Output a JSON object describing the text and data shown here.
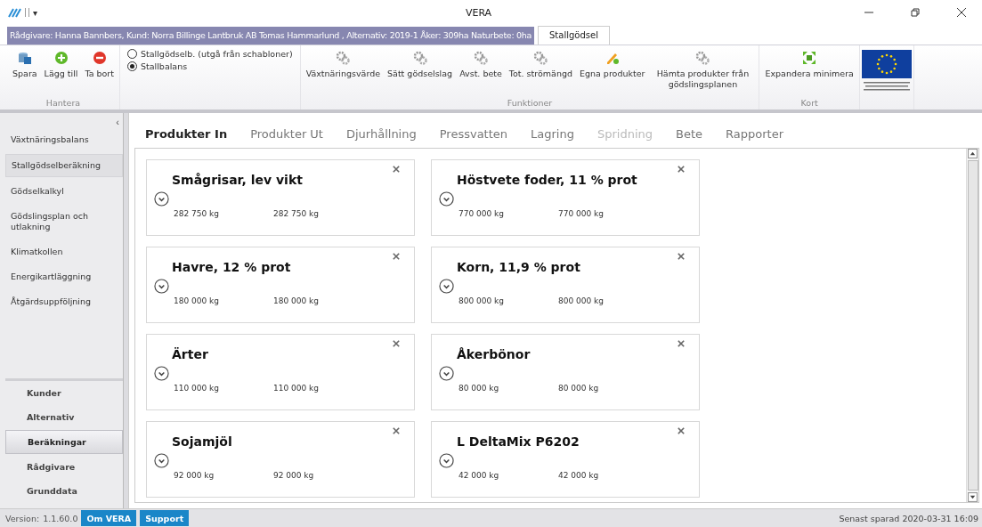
{
  "window": {
    "title": "VERA",
    "quick_access": "▾"
  },
  "info_tab": {
    "label": "Rådgivare: Hanna Bannbers, Kund:   Norra Billinge Lantbruk AB Tomas Hammarlund , Alternativ:  2019-1 Åker: 309ha Naturbete: 0ha"
  },
  "ribbon_tabs": [
    {
      "label": "Stallgödsel",
      "selected": true
    }
  ],
  "ribbon_groups": [
    {
      "label": "Hantera",
      "buttons": [
        {
          "kind": "save",
          "label": "Spara",
          "disabled": false
        },
        {
          "kind": "add",
          "label": "Lägg till",
          "disabled": false
        },
        {
          "kind": "remove",
          "label": "Ta bort",
          "disabled": false
        }
      ]
    },
    {
      "kind": "radios",
      "options": [
        {
          "label": "Stallgödselb. (utgå från schabloner)",
          "selected": false
        },
        {
          "label": "Stallbalans",
          "selected": true
        }
      ]
    },
    {
      "label": "Funktioner",
      "buttons": [
        {
          "kind": "gear",
          "label": "Växtnäringsvärde",
          "disabled": false
        },
        {
          "kind": "gear",
          "label": "Sätt gödselslag",
          "disabled": false
        },
        {
          "kind": "gear",
          "label": "Avst. bete",
          "disabled": false
        },
        {
          "kind": "gear",
          "label": "Tot. strömängd",
          "disabled": false
        },
        {
          "kind": "pencil",
          "label": "Egna produkter",
          "disabled": false
        },
        {
          "kind": "gear",
          "label": "Hämta produkter från gödslingsplanen",
          "disabled": false
        }
      ]
    },
    {
      "label": "Kort",
      "buttons": [
        {
          "kind": "expand",
          "label": "Expandera minimera",
          "disabled": false
        }
      ]
    },
    {
      "kind": "logo"
    }
  ],
  "sidebar": {
    "collapse": "‹",
    "items": [
      {
        "label": "Växtnäringsbalans",
        "selected": false
      },
      {
        "label": "Stallgödselberäkning",
        "selected": true
      },
      {
        "label": "Gödselkalkyl",
        "selected": false
      },
      {
        "label": "Gödslingsplan och utlakning",
        "selected": false
      },
      {
        "label": "Klimatkollen",
        "selected": false
      },
      {
        "label": "Energikartläggning",
        "selected": false
      },
      {
        "label": "Åtgärdsuppföljning",
        "selected": false
      }
    ],
    "nav": [
      {
        "label": "Kunder",
        "selected": false
      },
      {
        "label": "Alternativ",
        "selected": false
      },
      {
        "label": "Beräkningar",
        "selected": true
      },
      {
        "label": "Rådgivare",
        "selected": false
      },
      {
        "label": "Grunddata",
        "selected": false
      }
    ]
  },
  "tabs": [
    {
      "label": "Produkter In",
      "selected": true,
      "disabled": false
    },
    {
      "label": "Produkter Ut",
      "selected": false,
      "disabled": false
    },
    {
      "label": "Djurhållning",
      "selected": false,
      "disabled": false
    },
    {
      "label": "Pressvatten",
      "selected": false,
      "disabled": false
    },
    {
      "label": "Lagring",
      "selected": false,
      "disabled": false
    },
    {
      "label": "Spridning",
      "selected": false,
      "disabled": true
    },
    {
      "label": "Bete",
      "selected": false,
      "disabled": false
    },
    {
      "label": "Rapporter",
      "selected": false,
      "disabled": false
    }
  ],
  "cards": [
    {
      "title": "Smågrisar, lev vikt",
      "value_1": "282 750 kg",
      "value_2": "282 750 kg"
    },
    {
      "title": "Höstvete foder, 11 % prot",
      "value_1": "770 000 kg",
      "value_2": "770 000 kg"
    },
    {
      "title": "Havre, 12 % prot",
      "value_1": "180 000 kg",
      "value_2": "180 000 kg"
    },
    {
      "title": "Korn, 11,9 % prot",
      "value_1": "800 000 kg",
      "value_2": "800 000 kg"
    },
    {
      "title": "Ärter",
      "value_1": "110 000 kg",
      "value_2": "110 000 kg"
    },
    {
      "title": "Åkerbönor",
      "value_1": "80 000 kg",
      "value_2": "80 000 kg"
    },
    {
      "title": "Sojamjöl",
      "value_1": "92 000 kg",
      "value_2": "92 000 kg"
    },
    {
      "title": "L DeltaMix P6202",
      "value_1": "42 000 kg",
      "value_2": "42 000 kg"
    }
  ],
  "status_bar": {
    "version_label": "Version:",
    "version": "1.1.60.0",
    "buttons": [
      "Om VERA",
      "Support"
    ],
    "saved": "Senast sparad 2020-03-31 16:09"
  }
}
